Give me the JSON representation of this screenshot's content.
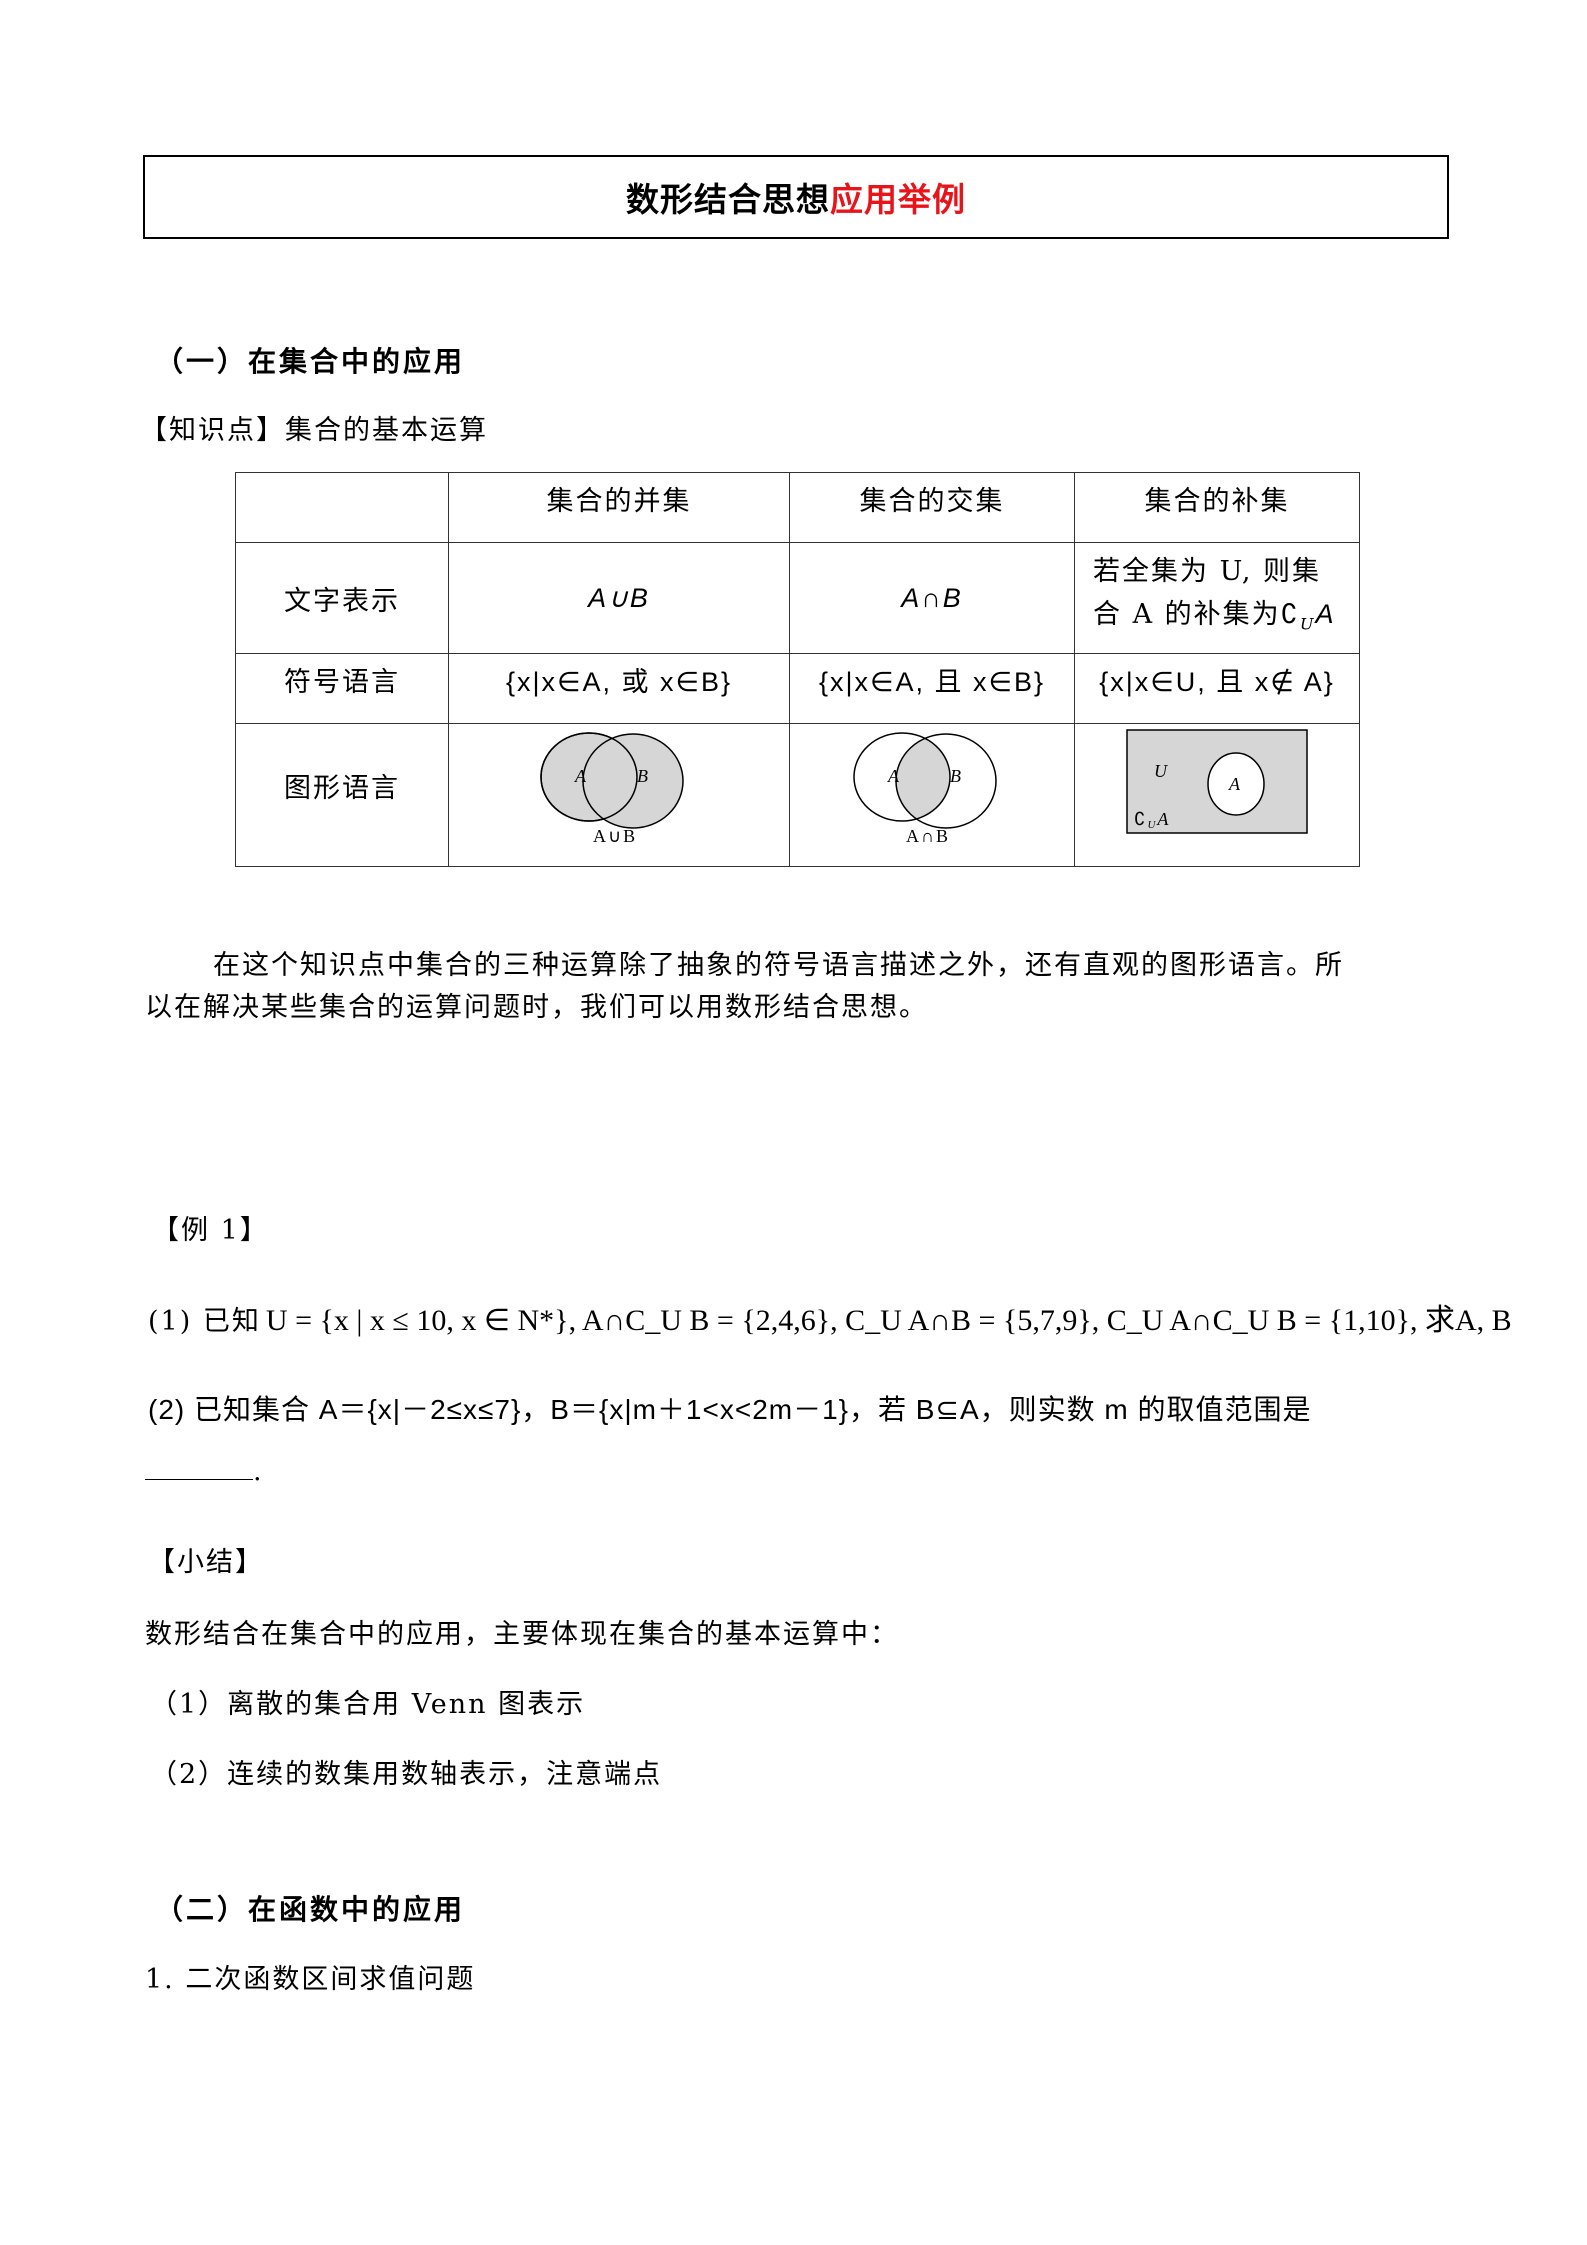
{
  "title": {
    "black": "数形结合思想",
    "red": "应用举例",
    "accent_color": "#e8141a"
  },
  "section1": {
    "heading": "（一）在集合中的应用",
    "knowledge_label": "【知识点】集合的基本运算",
    "table": {
      "headers": [
        "",
        "集合的并集",
        "集合的交集",
        "集合的补集"
      ],
      "rows": [
        {
          "label": "文字表示",
          "union": "A∪B",
          "intersection": "A∩B",
          "complement_line1": "若全集为 U, 则集",
          "complement_line2": "合 A 的补集为∁",
          "complement_sub": "U",
          "complement_tail": "A"
        },
        {
          "label": "符号语言",
          "union": "{x|x∈A,  或 x∈B}",
          "intersection": "{x|x∈A,  且 x∈B}",
          "complement": "{x|x∈U,  且 x∉ A}"
        },
        {
          "label": "图形语言",
          "venn_union": {
            "a": "A",
            "b": "B",
            "caption": "A∪B"
          },
          "venn_intersection": {
            "a": "A",
            "b": "B",
            "caption": "A∩B"
          },
          "venn_complement": {
            "u": "U",
            "a": "A",
            "caption": "∁",
            "caption_sub": "U",
            "caption_tail": "A"
          }
        }
      ]
    },
    "paragraph_line1": "在这个知识点中集合的三种运算除了抽象的符号语言描述之外，还有直观的图形语言。所",
    "paragraph_line2": "以在解决某些集合的运算问题时，我们可以用数形结合思想。"
  },
  "example1": {
    "label": "【例 1】",
    "q1": {
      "prefix": "(1) 已知",
      "expr": "U = {x | x ≤ 10, x ∈ N*}, A∩C_U B = {2,4,6}, C_U A∩B = {5,7,9}, C_U A∩C_U B = {1,10}, 求A, B"
    },
    "q2": {
      "text": "(2) 已知集合 A＝{x|－2≤x≤7}，B＝{x|m＋1<x<2m－1}，若 B⊆A，则实数 m 的取值范围是",
      "blank_tail": "."
    }
  },
  "summary": {
    "label": "【小结】",
    "intro": "数形结合在集合中的应用，主要体现在集合的基本运算中：",
    "items": [
      "（1）离散的集合用 Venn 图表示",
      "（2）连续的数集用数轴表示，注意端点"
    ]
  },
  "section2": {
    "heading": "（二）在函数中的应用",
    "subheading": "1. 二次函数区间求值问题"
  },
  "colors": {
    "venn_fill": "#d6d6d6"
  }
}
